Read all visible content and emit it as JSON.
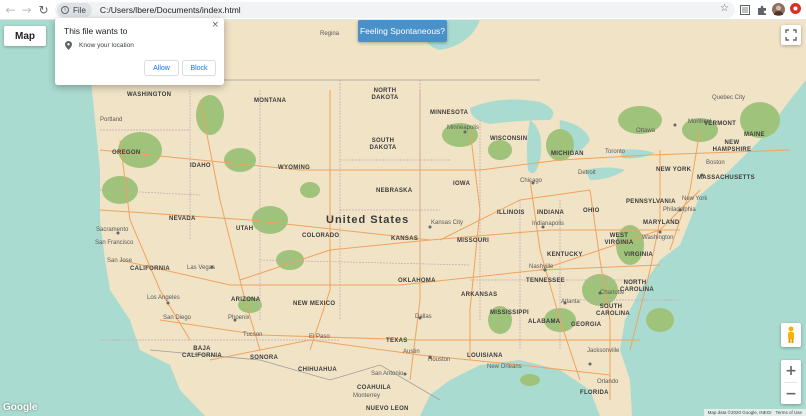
{
  "browser": {
    "back_icon": "back-arrow-icon",
    "forward_icon": "forward-arrow-icon",
    "reload_icon": "reload-icon",
    "site_chip_label": "File",
    "url": "C:/Users/lbere/Documents/index.html",
    "bookmark_icon": "star-icon",
    "toolbar_icons": [
      "tab-search-icon",
      "extensions-puzzle-icon",
      "profile-avatar",
      "extension-red-icon"
    ]
  },
  "permission_popup": {
    "title": "This file wants to",
    "permission": "Know your location",
    "allow_label": "Allow",
    "block_label": "Block",
    "close_symbol": "×"
  },
  "map": {
    "map_type_label": "Map",
    "feeling_button_label": "Feeling Spontaneous?",
    "google_logo": "Google",
    "attribution": "Map data ©2020 Google, INEGI",
    "terms": "Terms of Use",
    "zoom_in": "+",
    "zoom_out": "−",
    "country": "United States",
    "states": [
      {
        "name": "WASHINGTON"
      },
      {
        "name": "MONTANA"
      },
      {
        "name": "NORTH DAKOTA"
      },
      {
        "name": "MINNESOTA"
      },
      {
        "name": "SOUTH DAKOTA"
      },
      {
        "name": "WISCONSIN"
      },
      {
        "name": "MICHIGAN"
      },
      {
        "name": "OREGON"
      },
      {
        "name": "IDAHO"
      },
      {
        "name": "WYOMING"
      },
      {
        "name": "NEBRASKA"
      },
      {
        "name": "IOWA"
      },
      {
        "name": "NEVADA"
      },
      {
        "name": "UTAH"
      },
      {
        "name": "COLORADO"
      },
      {
        "name": "KANSAS"
      },
      {
        "name": "MISSOURI"
      },
      {
        "name": "ILLINOIS"
      },
      {
        "name": "INDIANA"
      },
      {
        "name": "OHIO"
      },
      {
        "name": "PENNSYLVANIA"
      },
      {
        "name": "NEW YORK"
      },
      {
        "name": "VERMONT"
      },
      {
        "name": "MAINE"
      },
      {
        "name": "NEW HAMPSHIRE"
      },
      {
        "name": "MASSACHUSETTS"
      },
      {
        "name": "CALIFORNIA"
      },
      {
        "name": "ARIZONA"
      },
      {
        "name": "NEW MEXICO"
      },
      {
        "name": "OKLAHOMA"
      },
      {
        "name": "ARKANSAS"
      },
      {
        "name": "TENNESSEE"
      },
      {
        "name": "KENTUCKY"
      },
      {
        "name": "WEST VIRGINIA"
      },
      {
        "name": "VIRGINIA"
      },
      {
        "name": "MARYLAND"
      },
      {
        "name": "NORTH CAROLINA"
      },
      {
        "name": "SOUTH CAROLINA"
      },
      {
        "name": "GEORGIA"
      },
      {
        "name": "ALABAMA"
      },
      {
        "name": "MISSISSIPPI"
      },
      {
        "name": "LOUISIANA"
      },
      {
        "name": "TEXAS"
      },
      {
        "name": "FLORIDA"
      },
      {
        "name": "BAJA CALIFORNIA"
      },
      {
        "name": "SONORA"
      },
      {
        "name": "CHIHUAHUA"
      },
      {
        "name": "COAHUILA"
      },
      {
        "name": "NUEVO LEON"
      },
      {
        "name": "VIRGINIA"
      }
    ],
    "cities": [
      {
        "name": "Regina"
      },
      {
        "name": "Quebec City"
      },
      {
        "name": "Ottawa"
      },
      {
        "name": "Montreal"
      },
      {
        "name": "Portland"
      },
      {
        "name": "Minneapolis"
      },
      {
        "name": "Toronto"
      },
      {
        "name": "Detroit"
      },
      {
        "name": "Chicago"
      },
      {
        "name": "Boston"
      },
      {
        "name": "New York"
      },
      {
        "name": "Philadelphia"
      },
      {
        "name": "Washington"
      },
      {
        "name": "Sacramento"
      },
      {
        "name": "San Francisco"
      },
      {
        "name": "San Jose"
      },
      {
        "name": "Kansas City"
      },
      {
        "name": "Indianapolis"
      },
      {
        "name": "Las Vegas"
      },
      {
        "name": "Los Angeles"
      },
      {
        "name": "San Diego"
      },
      {
        "name": "Phoenix"
      },
      {
        "name": "Tucson"
      },
      {
        "name": "Nashville"
      },
      {
        "name": "Charlotte"
      },
      {
        "name": "Atlanta"
      },
      {
        "name": "Dallas"
      },
      {
        "name": "El Paso"
      },
      {
        "name": "Austin"
      },
      {
        "name": "Houston"
      },
      {
        "name": "San Antonio"
      },
      {
        "name": "New Orleans"
      },
      {
        "name": "Jacksonville"
      },
      {
        "name": "Orlando"
      },
      {
        "name": "Monterrey"
      }
    ]
  },
  "colors": {
    "land": "#f0e3c6",
    "water": "#aadbd0",
    "forest": "#9fc37a",
    "roads": "#f0a35e",
    "button_blue": "#4a90c9"
  }
}
